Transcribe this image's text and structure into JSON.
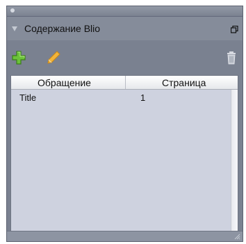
{
  "panel": {
    "title": "Содержание Blio"
  },
  "toolbar": {
    "add_icon": "plus-icon",
    "edit_icon": "pencil-icon",
    "delete_icon": "trash-icon"
  },
  "table": {
    "columns": [
      "Обращение",
      "Страница"
    ],
    "rows": [
      {
        "reference": "Title",
        "page": "1"
      }
    ]
  },
  "colors": {
    "panel_bg": "#7a8190",
    "list_bg": "#ced2df",
    "add_green": "#6cc23a",
    "pencil_orange": "#f2b43a"
  }
}
